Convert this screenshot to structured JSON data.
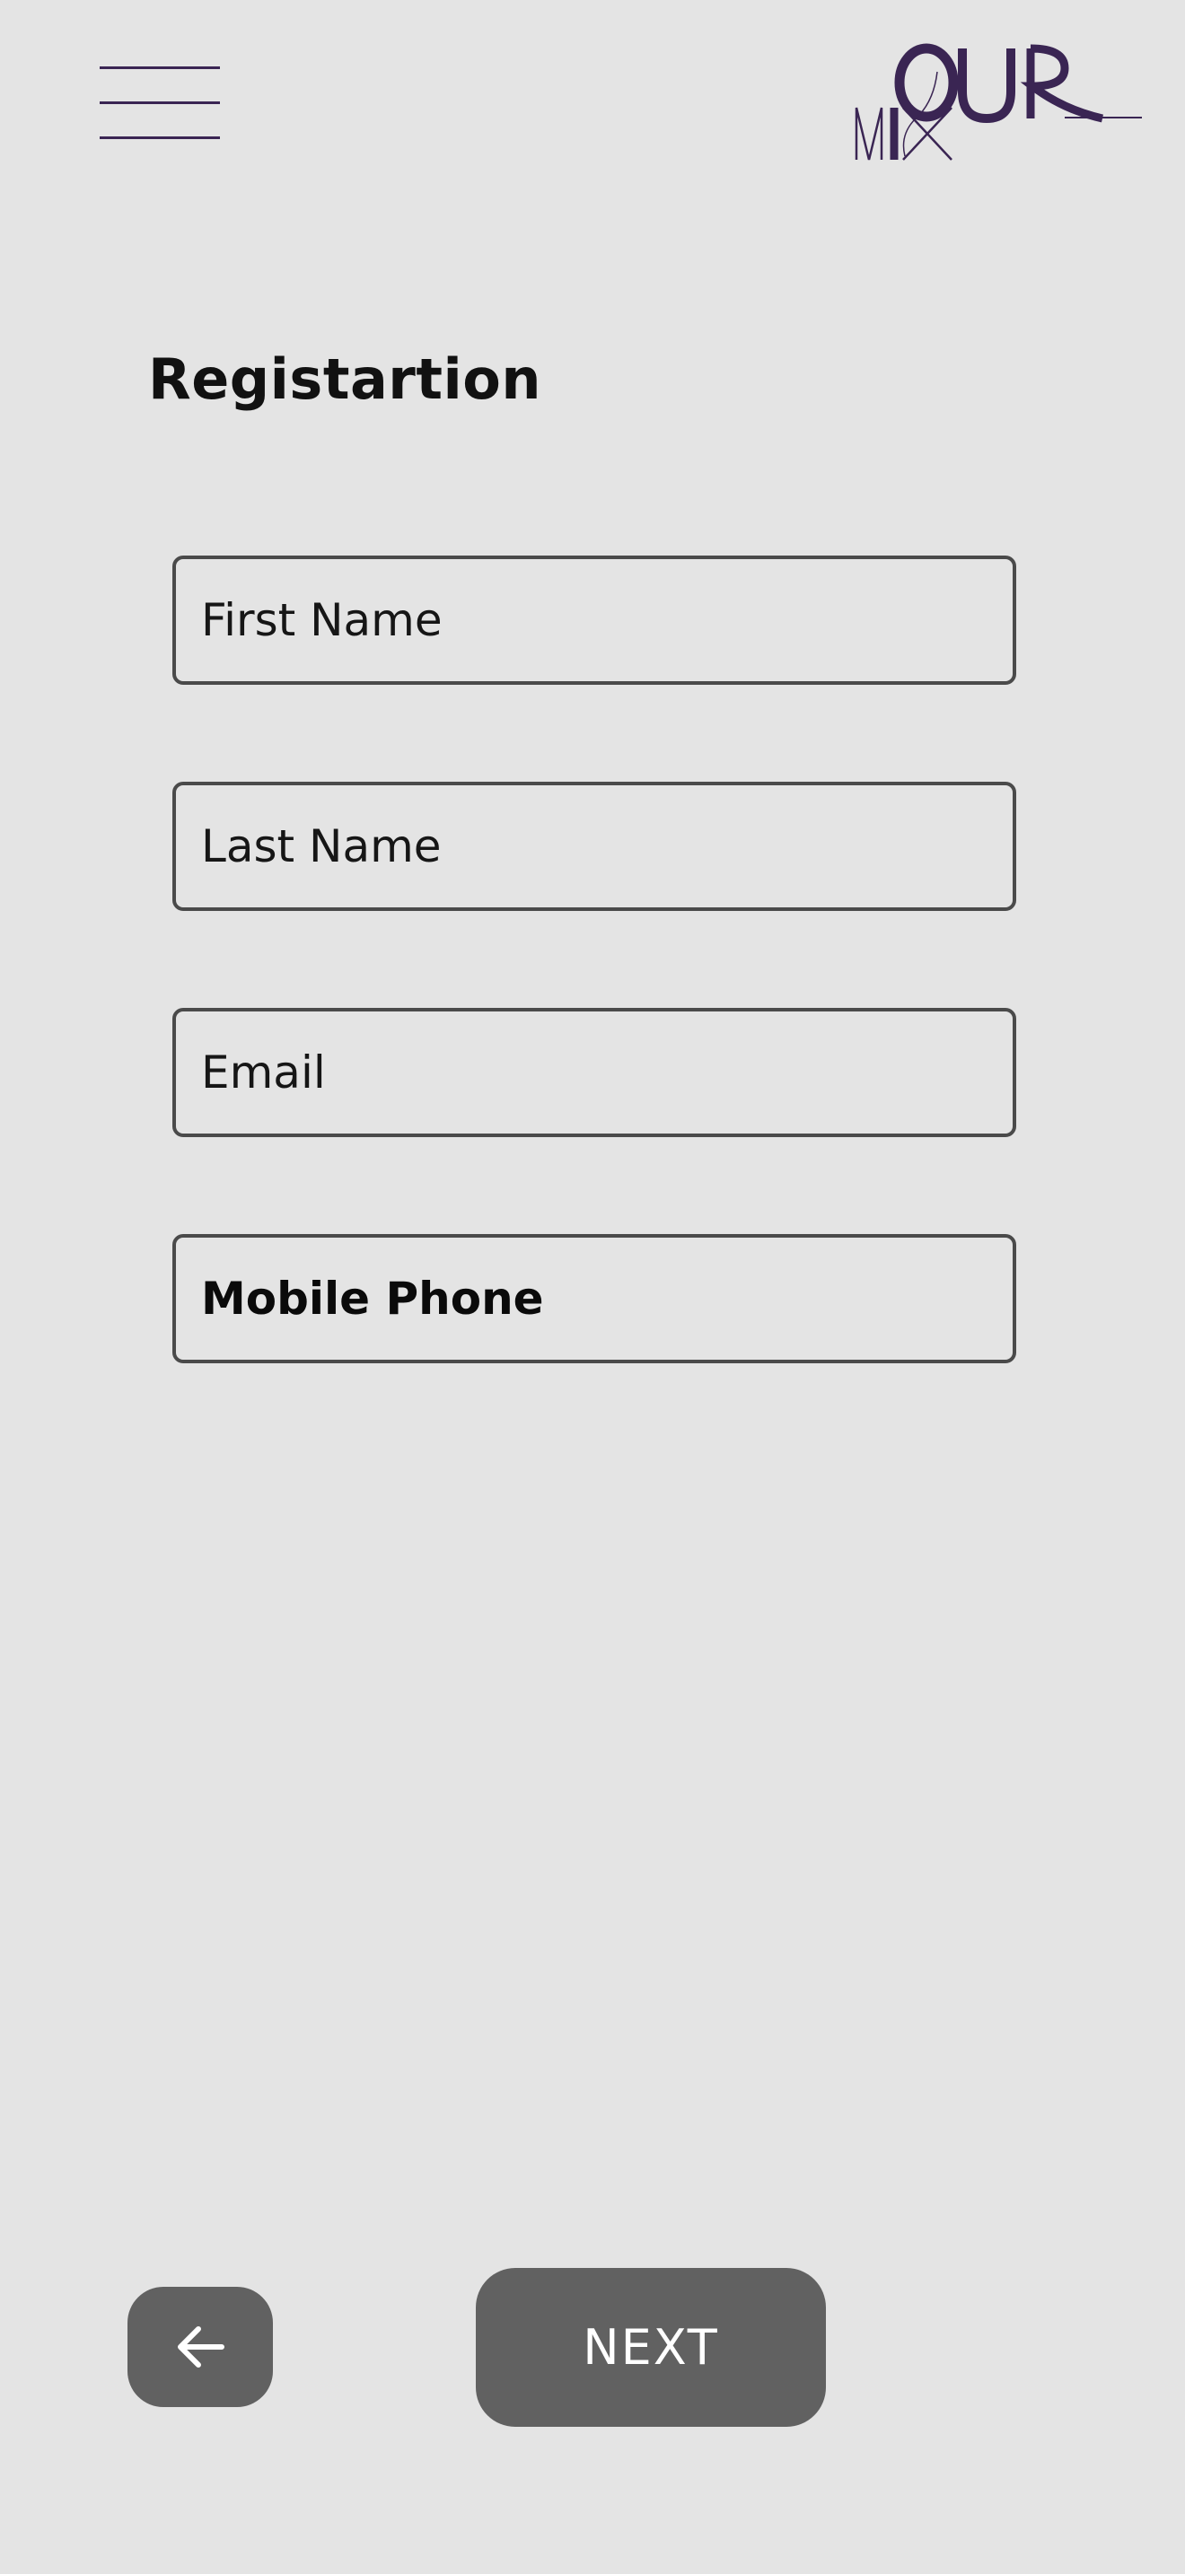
{
  "brand": {
    "logo_words": [
      "OUR",
      "MIX"
    ],
    "color": "#3a2553"
  },
  "page": {
    "title": "Registartion"
  },
  "form": {
    "first_name_placeholder": "First Name",
    "last_name_placeholder": "Last Name",
    "email_placeholder": "Email",
    "mobile_phone_placeholder": "Mobile Phone"
  },
  "footer": {
    "next_label": "NEXT",
    "back_icon": "arrow-left-icon"
  },
  "colors": {
    "background": "#e4e4e4",
    "button": "#616161",
    "field_border": "#4a4a4a"
  }
}
